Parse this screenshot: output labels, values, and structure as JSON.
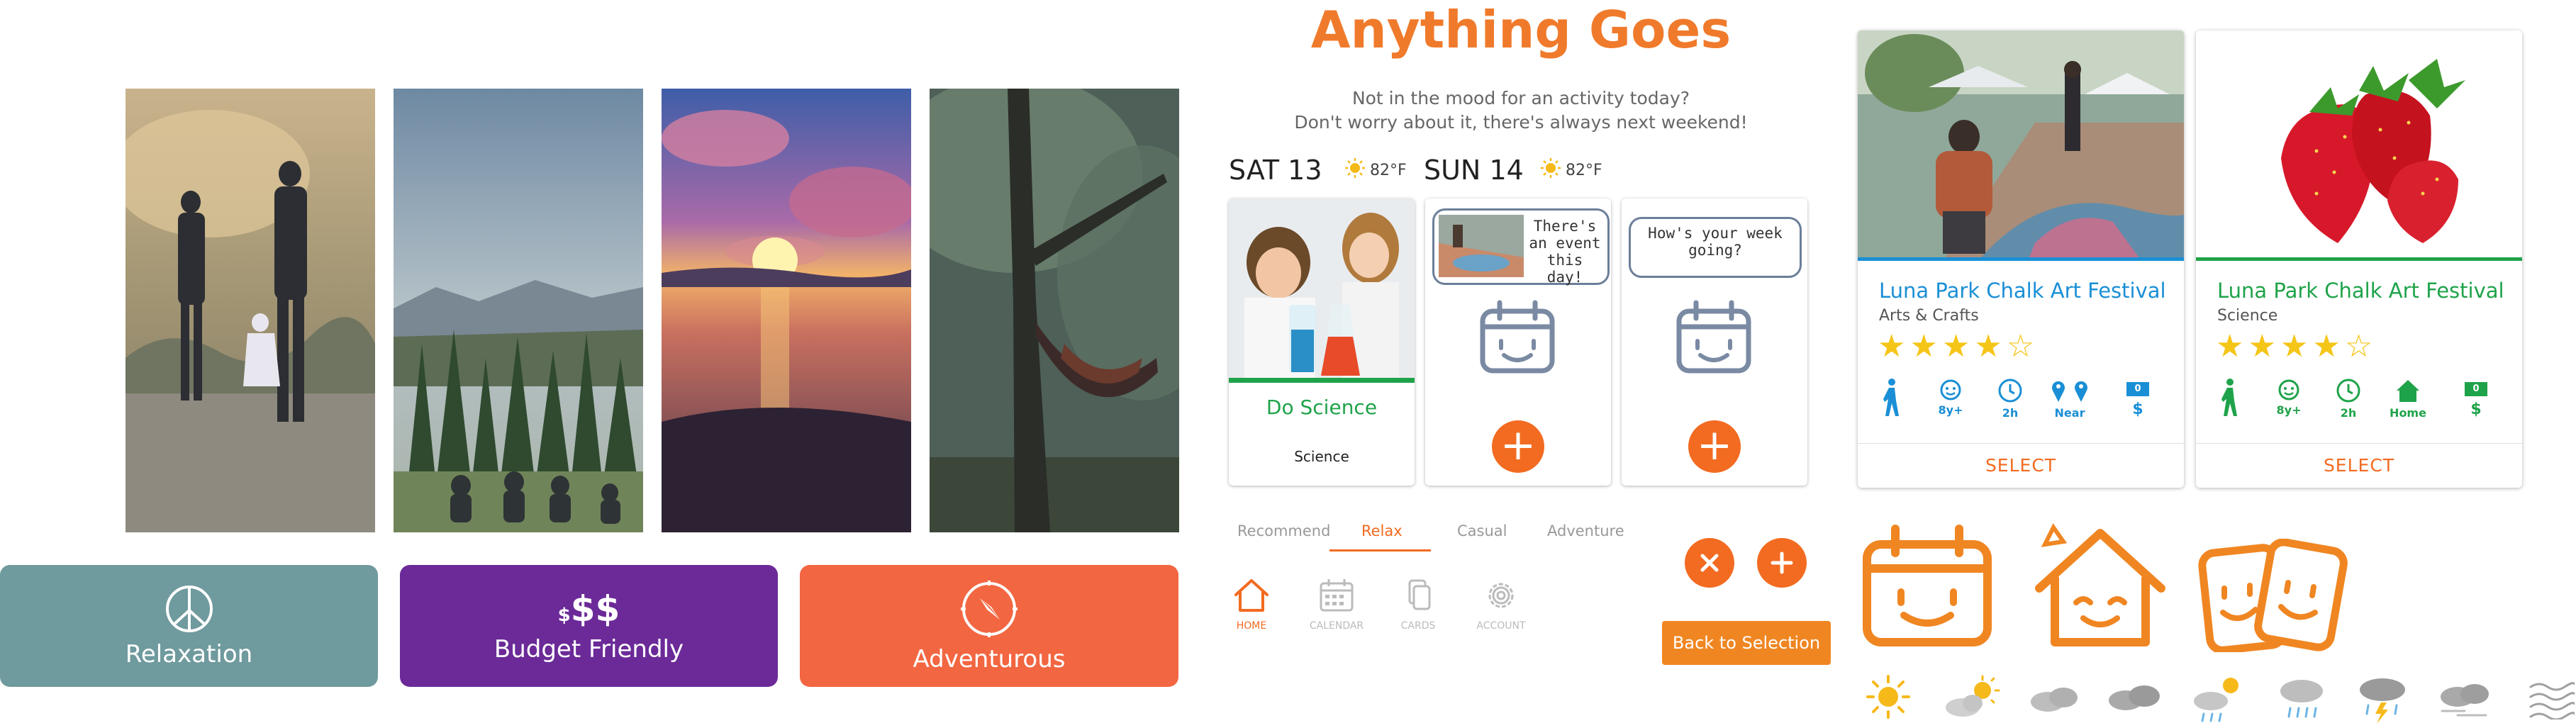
{
  "header": {
    "title": "Anything Goes",
    "subtitle_line1": "Not in the mood for an activity today?",
    "subtitle_line2": "Don't worry about it, there's always next weekend!"
  },
  "categories": [
    {
      "label": "Relaxation",
      "icon": "peace-icon",
      "color": "#6f9a9e"
    },
    {
      "label": "Budget Friendly",
      "icon": "dollar-icon",
      "prefix": "$",
      "icon_text": "$$",
      "color": "#6b2a98"
    },
    {
      "label": "Adventurous",
      "icon": "compass-icon",
      "color": "#f26641"
    }
  ],
  "weekend": {
    "sat": {
      "label": "SAT 13",
      "temp": "82°F"
    },
    "sun": {
      "label": "SUN 14",
      "temp": "82°F"
    }
  },
  "cards": {
    "science": {
      "title": "Do Science",
      "category": "Science"
    },
    "bubble1": "There's an event this day!",
    "bubble2": "How's your week going?"
  },
  "tabs": [
    "Recommend",
    "Relax",
    "Casual",
    "Adventure"
  ],
  "active_tab": "Relax",
  "nav": [
    {
      "label": "HOME",
      "icon": "home-icon"
    },
    {
      "label": "CALENDAR",
      "icon": "calendar-icon"
    },
    {
      "label": "CARDS",
      "icon": "cards-icon"
    },
    {
      "label": "ACCOUNT",
      "icon": "gear-icon"
    }
  ],
  "back_button": "Back to Selection",
  "events": [
    {
      "title": "Luna Park Chalk Art Festival",
      "category": "Arts & Crafts",
      "rating": 4,
      "stats": {
        "age": "8y+",
        "duration": "2h",
        "location": "Near",
        "price": "$",
        "price_badge": "0"
      },
      "select": "SELECT",
      "title_color": "#1a8fd6",
      "stat_color": "#1a8fd6"
    },
    {
      "title": "Luna Park Chalk Art Festival",
      "category": "Science",
      "rating": 4,
      "stats": {
        "age": "8y+",
        "duration": "2h",
        "location": "Home",
        "price": "$",
        "price_badge": "0"
      },
      "select": "SELECT",
      "title_color": "#1fa34a",
      "stat_color": "#1fa34a"
    }
  ],
  "colors": {
    "orange": "#f26b21",
    "brand_title": "#f07a2b",
    "star": "#f5c518",
    "green": "#1fa34a",
    "blue": "#1a8fd6"
  },
  "weather_icons": [
    "sun-icon",
    "partly-cloudy-icon",
    "cloudy-icon",
    "overcast-icon",
    "sun-shower-icon",
    "rain-icon",
    "thunderstorm-icon",
    "wind-cloud-icon",
    "haze-icon"
  ]
}
